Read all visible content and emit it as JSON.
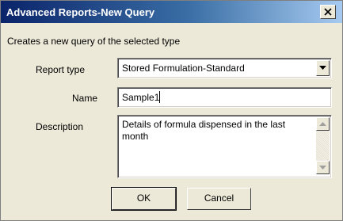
{
  "window": {
    "title": "Advanced Reports-New Query",
    "close_icon": "close-x-icon"
  },
  "form": {
    "intro": "Creates a new query of the selected type",
    "report_type": {
      "label": "Report type",
      "selected": "Stored Formulation-Standard",
      "icon": "chevron-down-icon"
    },
    "name": {
      "label": "Name",
      "value": "Sample1"
    },
    "description": {
      "label": "Description",
      "value": "Details of formula dispensed in the last month"
    }
  },
  "buttons": {
    "ok": "OK",
    "cancel": "Cancel"
  },
  "colors": {
    "titlebar_start": "#0a246a",
    "titlebar_end": "#a6caf0",
    "dialog_bg": "#ece9d8"
  }
}
